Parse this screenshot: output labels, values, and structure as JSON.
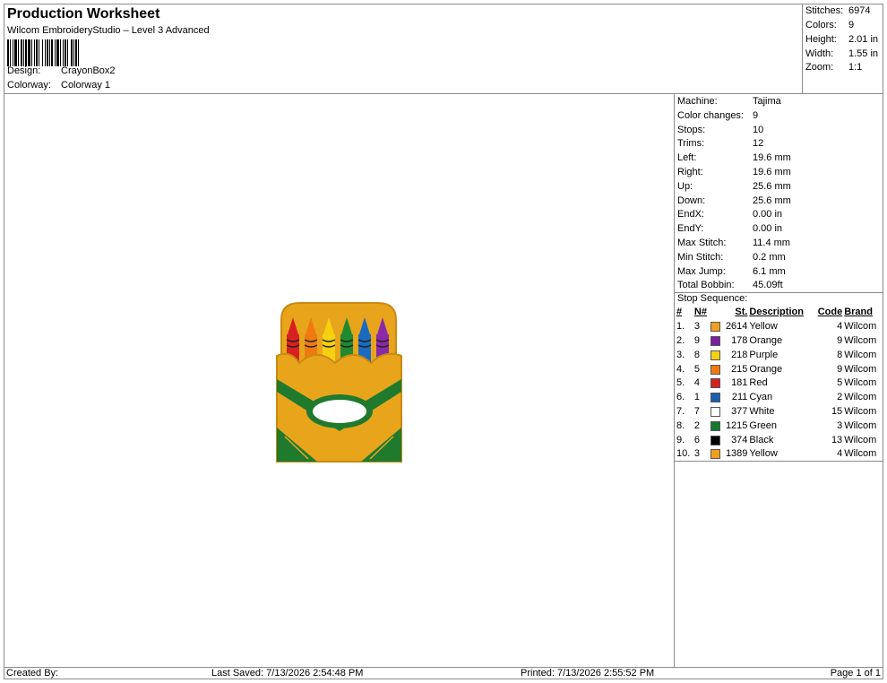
{
  "header": {
    "title": "Production Worksheet",
    "subtitle": "Wilcom EmbroideryStudio – Level 3 Advanced",
    "design_label": "Design:",
    "design_value": "CrayonBox2",
    "colorway_label": "Colorway:",
    "colorway_value": "Colorway 1"
  },
  "stats": [
    {
      "label": "Stitches:",
      "value": "6974"
    },
    {
      "label": "Colors:",
      "value": "9"
    },
    {
      "label": "Height:",
      "value": "2.01 in"
    },
    {
      "label": "Width:",
      "value": "1.55 in"
    },
    {
      "label": "Zoom:",
      "value": "1:1"
    }
  ],
  "machine_info": [
    {
      "label": "Machine:",
      "value": "Tajima"
    },
    {
      "label": "Color changes:",
      "value": "9"
    },
    {
      "label": "Stops:",
      "value": "10"
    },
    {
      "label": "Trims:",
      "value": "12"
    },
    {
      "label": "Left:",
      "value": "19.6 mm"
    },
    {
      "label": "Right:",
      "value": "19.6 mm"
    },
    {
      "label": "Up:",
      "value": "25.6 mm"
    },
    {
      "label": "Down:",
      "value": "25.6 mm"
    },
    {
      "label": "EndX:",
      "value": "0.00 in"
    },
    {
      "label": "EndY:",
      "value": "0.00 in"
    },
    {
      "label": "Max Stitch:",
      "value": "11.4 mm"
    },
    {
      "label": "Min Stitch:",
      "value": "0.2 mm"
    },
    {
      "label": "Max Jump:",
      "value": "6.1 mm"
    },
    {
      "label": "Total Bobbin:",
      "value": "45.09ft"
    }
  ],
  "stop_sequence": {
    "title": "Stop Sequence:",
    "headers": [
      "#",
      "N#",
      "St.",
      "Description",
      "Code",
      "Brand"
    ],
    "rows": [
      {
        "idx": "1.",
        "n": "3",
        "color": "#f0a020",
        "st": "2614",
        "desc": "Yellow",
        "code": "4",
        "brand": "Wilcom"
      },
      {
        "idx": "2.",
        "n": "9",
        "color": "#7a1fa0",
        "st": "178",
        "desc": "Orange",
        "code": "9",
        "brand": "Wilcom"
      },
      {
        "idx": "3.",
        "n": "8",
        "color": "#f5d010",
        "st": "218",
        "desc": "Purple",
        "code": "8",
        "brand": "Wilcom"
      },
      {
        "idx": "4.",
        "n": "5",
        "color": "#f07a10",
        "st": "215",
        "desc": "Orange",
        "code": "9",
        "brand": "Wilcom"
      },
      {
        "idx": "5.",
        "n": "4",
        "color": "#d82020",
        "st": "181",
        "desc": "Red",
        "code": "5",
        "brand": "Wilcom"
      },
      {
        "idx": "6.",
        "n": "1",
        "color": "#1a60b0",
        "st": "211",
        "desc": "Cyan",
        "code": "2",
        "brand": "Wilcom"
      },
      {
        "idx": "7.",
        "n": "7",
        "color": "#ffffff",
        "st": "377",
        "desc": "White",
        "code": "15",
        "brand": "Wilcom"
      },
      {
        "idx": "8.",
        "n": "2",
        "color": "#157a30",
        "st": "1215",
        "desc": "Green",
        "code": "3",
        "brand": "Wilcom"
      },
      {
        "idx": "9.",
        "n": "6",
        "color": "#000000",
        "st": "374",
        "desc": "Black",
        "code": "13",
        "brand": "Wilcom"
      },
      {
        "idx": "10.",
        "n": "3",
        "color": "#f0a020",
        "st": "1389",
        "desc": "Yellow",
        "code": "4",
        "brand": "Wilcom"
      }
    ]
  },
  "footer": {
    "created_by": "Created By:",
    "last_saved": "Last Saved: 7/13/2026 2:54:48 PM",
    "printed": "Printed: 7/13/2026 2:55:52 PM",
    "page": "Page 1 of 1"
  },
  "design_colors": {
    "box_gold": "#e8a51c",
    "box_outline": "#c98a10",
    "green": "#1f7a2e",
    "oval_fill": "#ffffff"
  }
}
